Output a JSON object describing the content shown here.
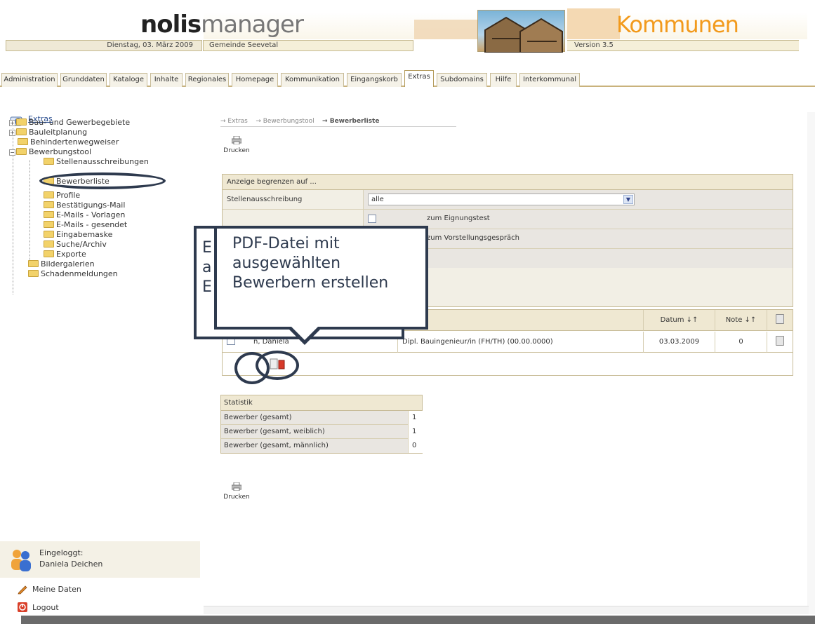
{
  "header": {
    "logo_bold": "nolis",
    "logo_light": "manager",
    "date": "Dienstag, 03. März 2009",
    "community": "Gemeinde Seevetal",
    "product": "Kommunen",
    "version": "Version 3.5"
  },
  "tabs": [
    {
      "label": "Administration"
    },
    {
      "label": "Grunddaten"
    },
    {
      "label": "Kataloge"
    },
    {
      "label": "Inhalte"
    },
    {
      "label": "Regionales"
    },
    {
      "label": "Homepage"
    },
    {
      "label": "Kommunikation"
    },
    {
      "label": "Eingangskorb"
    },
    {
      "label": "Extras"
    },
    {
      "label": "Subdomains"
    },
    {
      "label": "Hilfe"
    },
    {
      "label": "Interkommunal"
    }
  ],
  "sidebar": {
    "root": "Extras",
    "items": [
      {
        "label": "Bau- und Gewerbegebiete"
      },
      {
        "label": "Bauleitplanung"
      },
      {
        "label": "Behindertenwegweiser"
      },
      {
        "label": "Bewerbungstool"
      },
      {
        "label": "Stellenausschreibungen"
      },
      {
        "label": "Bewerberliste"
      },
      {
        "label": "Profile"
      },
      {
        "label": "Bestätigungs-Mail"
      },
      {
        "label": "E-Mails - Vorlagen"
      },
      {
        "label": "E-Mails - gesendet"
      },
      {
        "label": "Eingabemaske"
      },
      {
        "label": "Suche/Archiv"
      },
      {
        "label": "Exporte"
      },
      {
        "label": "Bildergalerien"
      },
      {
        "label": "Schadenmeldungen"
      }
    ],
    "login_label": "Eingeloggt:",
    "login_user": "Daniela Deichen",
    "my_data": "Meine Daten",
    "logout": "Logout"
  },
  "main": {
    "breadcrumb": [
      "→ Extras",
      "→ Bewerbungstool",
      "→ Bewerberliste"
    ],
    "print_label": "Drucken",
    "filter": {
      "title": "Anzeige begrenzen auf ...",
      "job_label": "Stellenausschreibung",
      "job_value": "alle",
      "cb1": "zum Eignungstest",
      "cb2": "zum Vorstellungsgespräch"
    },
    "table": {
      "col_datum": "Datum ↓↑",
      "col_note": "Note ↓↑",
      "rows": [
        {
          "name": "n, Daniela",
          "position": "Dipl. Bauingenieur/in (FH/TH) (00.00.0000)",
          "date": "03.03.2009",
          "note": "0"
        }
      ]
    },
    "stats": {
      "title": "Statistik",
      "rows": [
        {
          "label": "Bewerber (gesamt)",
          "value": "1"
        },
        {
          "label": "Bewerber (gesamt, weiblich)",
          "value": "1"
        },
        {
          "label": "Bewerber (gesamt, männlich)",
          "value": "0"
        }
      ]
    }
  },
  "callout": {
    "text": "PDF-Datei mit ausgewählten Bewerbern erstellen",
    "back_letters": "E\na\nE"
  },
  "colors": {
    "accent": "#f29a1c",
    "callout": "#2e3a4e",
    "link": "#2a4d8f"
  }
}
